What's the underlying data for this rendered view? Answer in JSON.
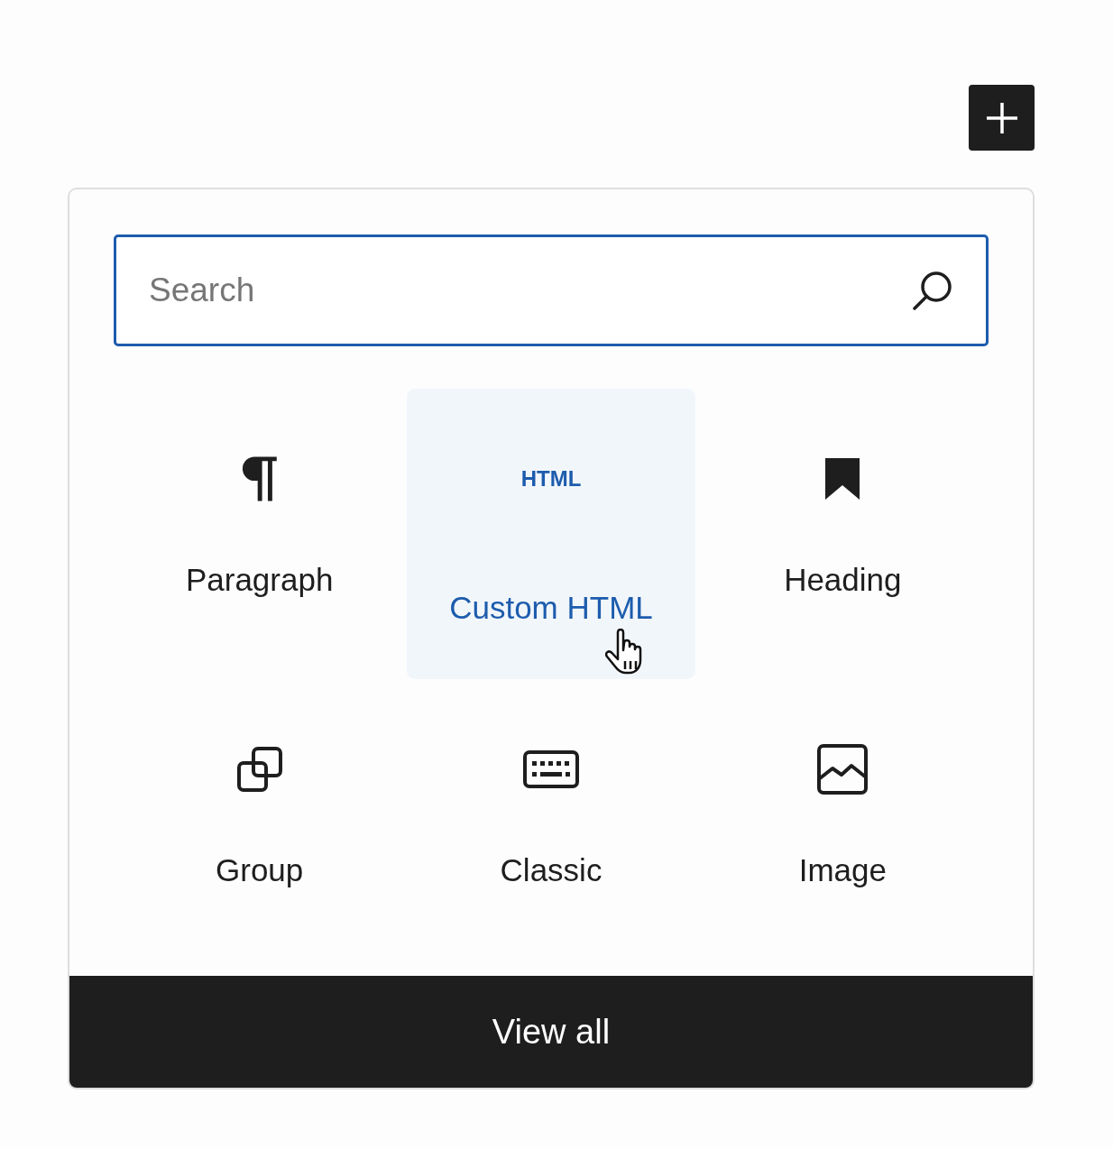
{
  "search": {
    "placeholder": "Search"
  },
  "blocks": [
    {
      "kind": "paragraph",
      "label": "Paragraph",
      "hovered": false
    },
    {
      "kind": "html",
      "icon_text": "HTML",
      "label": "Custom HTML",
      "hovered": true
    },
    {
      "kind": "heading",
      "label": "Heading",
      "hovered": false
    },
    {
      "kind": "group",
      "label": "Group",
      "hovered": false
    },
    {
      "kind": "classic",
      "label": "Classic",
      "hovered": false
    },
    {
      "kind": "image",
      "label": "Image",
      "hovered": false
    }
  ],
  "footer": {
    "button": "View all"
  }
}
